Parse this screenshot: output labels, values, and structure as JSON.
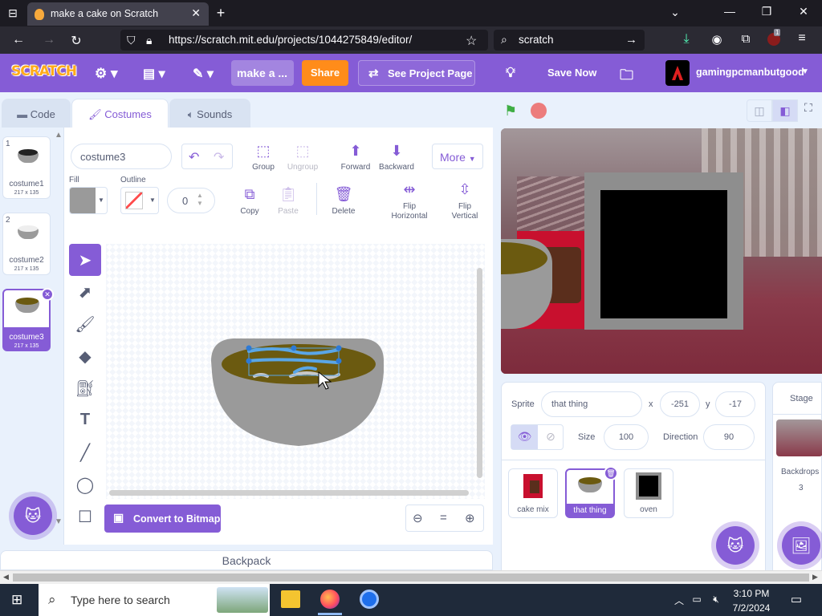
{
  "browser": {
    "tab_title": "make a cake on Scratch",
    "url_prefix": "https://",
    "url_host": "scratch.mit.edu",
    "url_path": "/projects/1044275849/editor/",
    "search_text": "scratch",
    "ext_badge": "1"
  },
  "menu": {
    "logo": "SCRATCH",
    "project_title": "make a ...",
    "share": "Share",
    "see_project": "See Project Page",
    "save_now": "Save Now",
    "username": "gamingpcmanbutgood"
  },
  "tabs": [
    {
      "label": "Code"
    },
    {
      "label": "Costumes"
    },
    {
      "label": "Sounds"
    }
  ],
  "costumes": [
    {
      "num": "1",
      "name": "costume1",
      "size": "217 x 135"
    },
    {
      "num": "2",
      "name": "costume2",
      "size": "217 x 135"
    },
    {
      "num": "3",
      "name": "costume3",
      "size": "217 x 135"
    }
  ],
  "paint": {
    "costume_name": "costume3",
    "fill_label": "Fill",
    "outline_label": "Outline",
    "outline_width": "0",
    "group": "Group",
    "ungroup": "Ungroup",
    "forward": "Forward",
    "backward": "Backward",
    "more": "More",
    "copy": "Copy",
    "paste": "Paste",
    "delete": "Delete",
    "flip_h": "Flip Horizontal",
    "flip_v": "Flip Vertical",
    "convert": "Convert to Bitmap",
    "fill_color": "#9a9a9a",
    "accent": "#855cd6"
  },
  "backpack": "Backpack",
  "sprite": {
    "label": "Sprite",
    "name": "that thing",
    "x_label": "x",
    "x": "-251",
    "y_label": "y",
    "y": "-17",
    "size_label": "Size",
    "size": "100",
    "direction_label": "Direction",
    "direction": "90"
  },
  "sprites": [
    {
      "name": "cake mix"
    },
    {
      "name": "that thing"
    },
    {
      "name": "oven"
    }
  ],
  "stage_pane": {
    "title": "Stage",
    "backdrops_label": "Backdrops",
    "backdrops_count": "3"
  },
  "taskbar": {
    "search_placeholder": "Type here to search",
    "time": "3:10 PM",
    "date": "7/2/2024"
  }
}
